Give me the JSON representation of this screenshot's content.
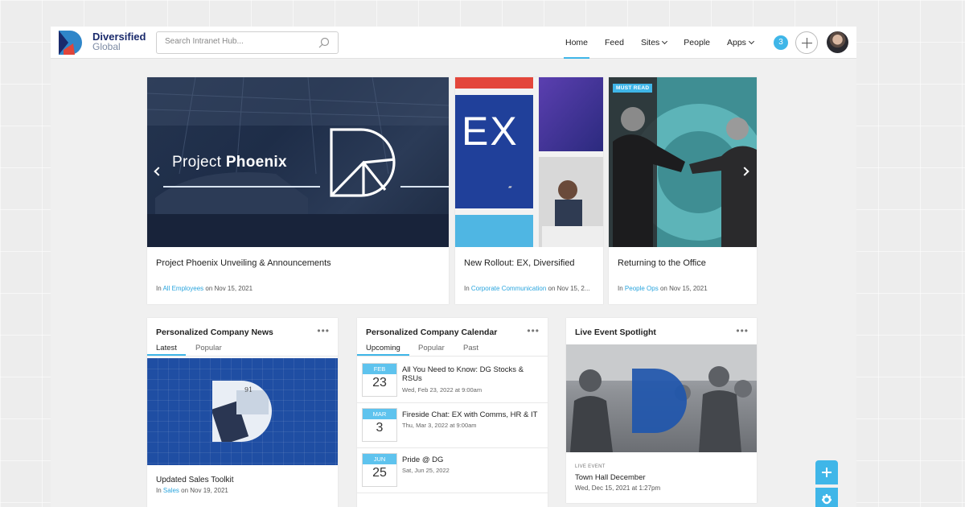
{
  "header": {
    "brand_line1": "Diversified",
    "brand_line2": "Global",
    "search_placeholder": "Search Intranet Hub...",
    "nav": [
      {
        "label": "Home",
        "active": true
      },
      {
        "label": "Feed"
      },
      {
        "label": "Sites",
        "dropdown": true
      },
      {
        "label": "People"
      },
      {
        "label": "Apps",
        "dropdown": true
      }
    ],
    "notification_count": "3"
  },
  "featured": [
    {
      "hero_text_light": "Project ",
      "hero_text_bold": "Phoenix",
      "title": "Project Phoenix Unveiling & Announcements",
      "meta_prefix": "In ",
      "meta_link": "All Employees",
      "meta_suffix": " on Nov 15, 2021"
    },
    {
      "hero_text": "EX",
      "title": "New Rollout: EX, Diversified",
      "meta_prefix": "In ",
      "meta_link": "Corporate Communication",
      "meta_suffix": " on Nov 15, 2..."
    },
    {
      "badge": "MUST READ",
      "title": "Returning to the Office",
      "meta_prefix": "In ",
      "meta_link": "People Ops",
      "meta_suffix": " on Nov 15, 2021"
    }
  ],
  "news": {
    "title": "Personalized Company News",
    "tabs": [
      "Latest",
      "Popular"
    ],
    "item_title": "Updated Sales Toolkit",
    "item_meta_prefix": "In ",
    "item_meta_link": "Sales",
    "item_meta_suffix": " on Nov 19, 2021"
  },
  "calendar": {
    "title": "Personalized Company Calendar",
    "tabs": [
      "Upcoming",
      "Popular",
      "Past"
    ],
    "events": [
      {
        "month": "FEB",
        "day": "23",
        "title": "All You Need to Know: DG Stocks & RSUs",
        "time": "Wed, Feb 23, 2022 at 9:00am"
      },
      {
        "month": "MAR",
        "day": "3",
        "title": "Fireside Chat: EX with Comms, HR & IT",
        "time": "Thu, Mar 3, 2022 at 9:00am"
      },
      {
        "month": "JUN",
        "day": "25",
        "title": "Pride @ DG",
        "time": "Sat, Jun 25, 2022"
      }
    ]
  },
  "spotlight": {
    "title": "Live Event Spotlight",
    "label": "LIVE EVENT",
    "event_title": "Town Hall December",
    "event_time": "Wed, Dec 15, 2021 at 1:27pm"
  },
  "menu_dots": "•••",
  "colors": {
    "accent": "#3fb6e8",
    "brand_navy": "#1a2a6c",
    "brand_blue": "#1f4ea3"
  }
}
